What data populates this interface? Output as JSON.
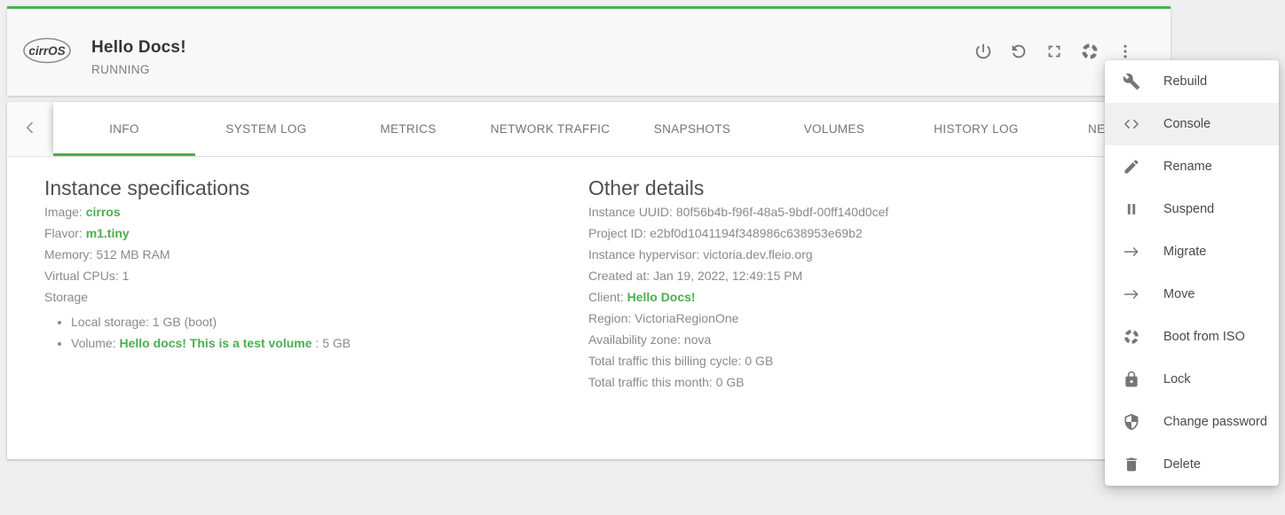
{
  "colors": {
    "accent": "#4caf50",
    "link_green": "#4caf50",
    "page_background": "#efefef"
  },
  "header": {
    "logo": "cirrOS",
    "title": "Hello Docs!",
    "status": "RUNNING",
    "actions": [
      {
        "icon": "power-icon"
      },
      {
        "icon": "reboot-icon"
      },
      {
        "icon": "fullscreen-console-icon"
      },
      {
        "icon": "boot-from-iso-icon"
      },
      {
        "icon": "more-actions-icon"
      }
    ]
  },
  "tabs": {
    "active": "INFO",
    "paginator_icon": "chevron-left-icon",
    "items": [
      {
        "label": "INFO"
      },
      {
        "label": "SYSTEM LOG"
      },
      {
        "label": "METRICS"
      },
      {
        "label": "NETWORK TRAFFIC"
      },
      {
        "label": "SNAPSHOTS"
      },
      {
        "label": "VOLUMES"
      },
      {
        "label": "HISTORY LOG"
      },
      {
        "label": "NE"
      }
    ]
  },
  "specs": {
    "heading": "Instance specifications",
    "rows": [
      {
        "label": "Image:",
        "value": "cirros"
      },
      {
        "label": "Flavor:",
        "value": "m1.tiny"
      },
      {
        "label": "Memory:",
        "value": "512 MB RAM"
      },
      {
        "label": "Virtual CPUs:",
        "value": "1"
      }
    ],
    "storage": {
      "label": "Storage",
      "items": [
        {
          "text": "Local storage: 1 GB (boot)"
        },
        {
          "prefix": "Volume: ",
          "link": "Hello docs! This is a test volume",
          "suffix": " : 5 GB"
        }
      ]
    }
  },
  "details": {
    "heading": "Other details",
    "rows": [
      {
        "label": "Instance UUID:",
        "value": "80f56b4b-f96f-48a5-9bdf-00ff140d0cef"
      },
      {
        "label": "Project ID:",
        "value": "e2bf0d1041194f348986c638953e69b2"
      },
      {
        "label": "Instance hypervisor:",
        "value": "victoria.dev.fleio.org"
      },
      {
        "label": "Created at:",
        "value": "Jan 19, 2022, 12:49:15 PM"
      },
      {
        "label": "Client:",
        "value": "Hello Docs!"
      },
      {
        "label": "Region:",
        "value": "VictoriaRegionOne"
      },
      {
        "label": "Availability zone:",
        "value": "nova"
      },
      {
        "label": "Total traffic this billing cycle:",
        "value": "0 GB"
      },
      {
        "label": "Total traffic this month:",
        "value": "0 GB"
      }
    ]
  },
  "menu": {
    "highlighted": "Console",
    "items": [
      {
        "icon": "wrench-icon",
        "label": "Rebuild"
      },
      {
        "icon": "code-icon",
        "label": "Console"
      },
      {
        "icon": "pencil-icon",
        "label": "Rename"
      },
      {
        "icon": "pause-icon",
        "label": "Suspend"
      },
      {
        "icon": "arrow-right-icon",
        "label": "Migrate"
      },
      {
        "icon": "arrow-right-icon",
        "label": "Move"
      },
      {
        "icon": "boot-from-iso-icon",
        "label": "Boot from ISO"
      },
      {
        "icon": "lock-icon",
        "label": "Lock"
      },
      {
        "icon": "shield-icon",
        "label": "Change password"
      },
      {
        "icon": "trash-icon",
        "label": "Delete"
      }
    ]
  }
}
